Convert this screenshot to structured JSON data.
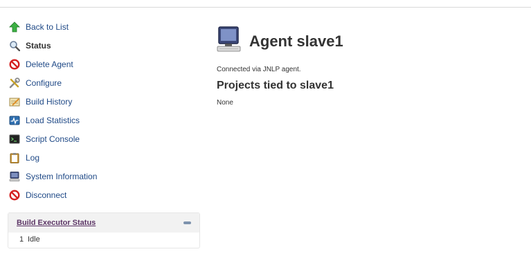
{
  "sidebar": {
    "items": [
      {
        "label": "Back to List",
        "icon": "up-arrow-icon"
      },
      {
        "label": "Status",
        "icon": "magnifier-icon"
      },
      {
        "label": "Delete Agent",
        "icon": "no-entry-icon"
      },
      {
        "label": "Configure",
        "icon": "tools-icon"
      },
      {
        "label": "Build History",
        "icon": "notepad-icon"
      },
      {
        "label": "Load Statistics",
        "icon": "monitor-graph-icon"
      },
      {
        "label": "Script Console",
        "icon": "terminal-icon"
      },
      {
        "label": "Log",
        "icon": "clipboard-icon"
      },
      {
        "label": "System Information",
        "icon": "computer-icon"
      },
      {
        "label": "Disconnect",
        "icon": "no-entry-icon"
      }
    ]
  },
  "executors": {
    "title": "Build Executor Status",
    "rows": [
      {
        "num": "1",
        "state": "Idle"
      }
    ]
  },
  "main": {
    "title": "Agent slave1",
    "connected": "Connected via JNLP agent.",
    "projects_heading": "Projects tied to slave1",
    "projects_value": "None"
  },
  "colors": {
    "link": "#204a87",
    "visited": "#5c3566",
    "accent": "#7d92ad"
  }
}
